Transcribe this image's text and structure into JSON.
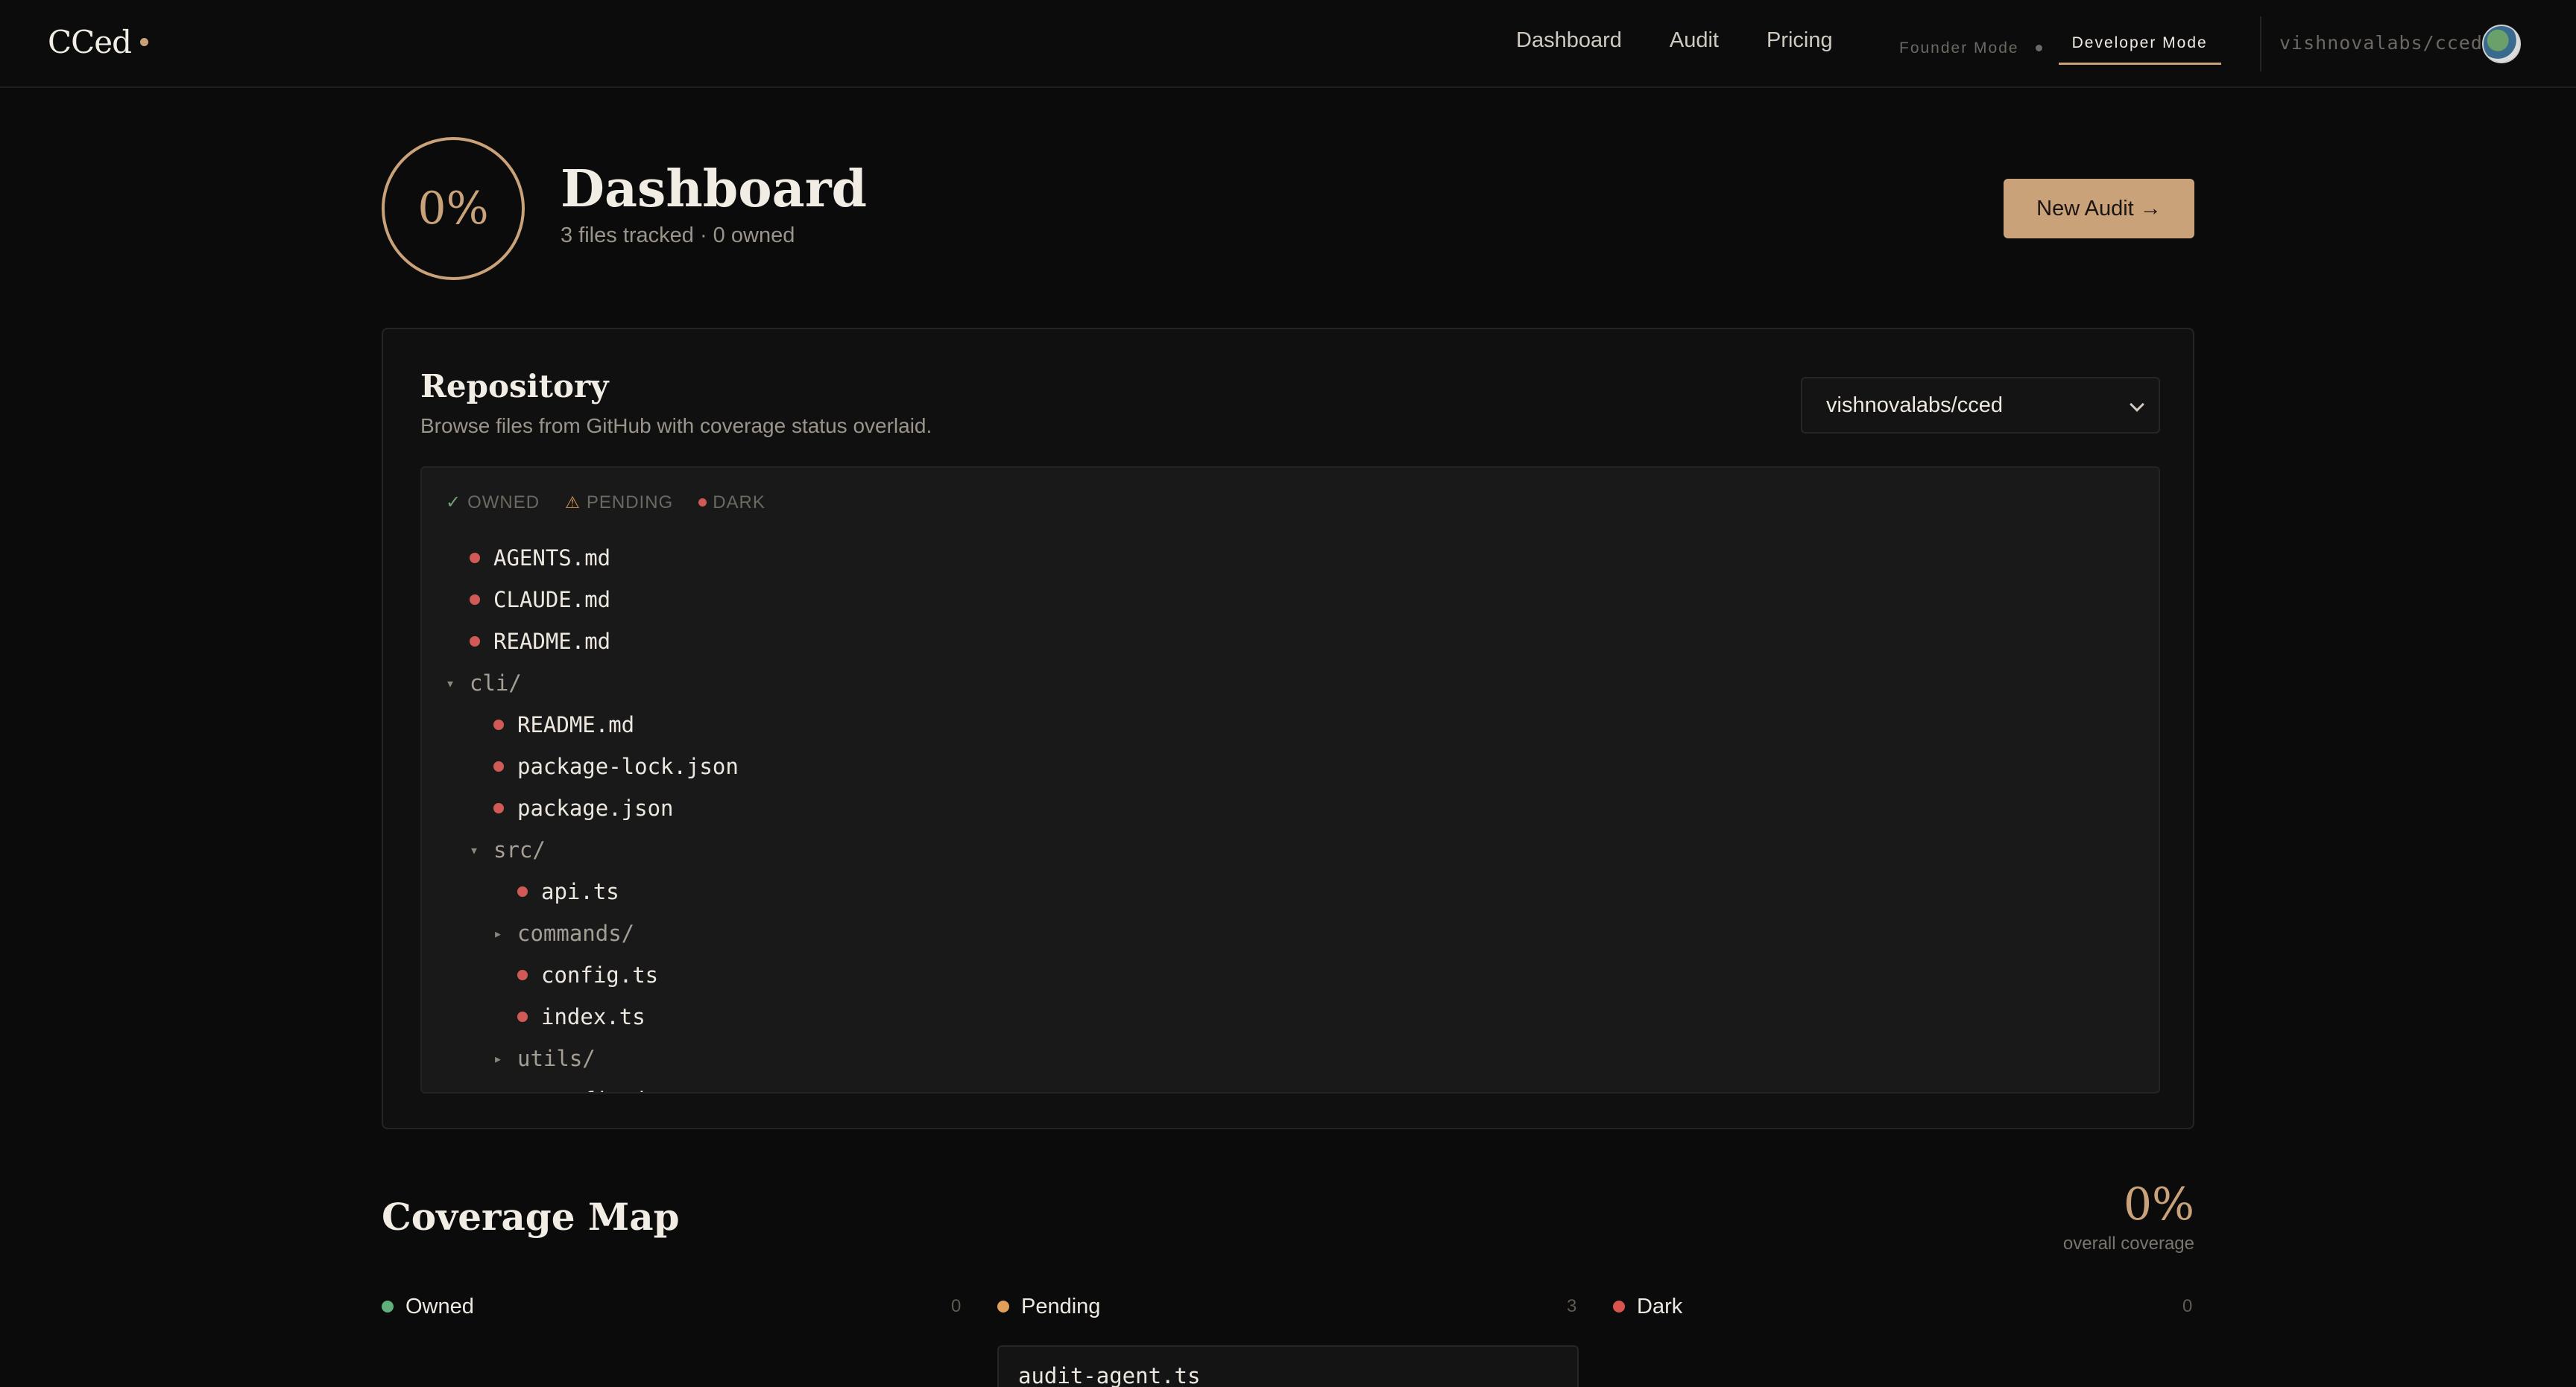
{
  "nav": {
    "logo": "CCed",
    "links": [
      "Dashboard",
      "Audit",
      "Pricing"
    ],
    "modes": {
      "founder": "Founder Mode",
      "developer": "Developer Mode",
      "active": "developer"
    },
    "repo": "vishnovalabs/cced"
  },
  "header": {
    "ring_pct": "0%",
    "title": "Dashboard",
    "subtitle": "3 files tracked · 0 owned",
    "new_audit": "New Audit →"
  },
  "repository": {
    "title": "Repository",
    "description": "Browse files from GitHub with coverage status overlaid.",
    "selected_repo": "vishnovalabs/cced",
    "legend": {
      "owned": "OWNED",
      "pending": "PENDING",
      "dark": "DARK"
    },
    "tree": [
      {
        "type": "file",
        "name": "AGENTS.md",
        "depth": 0,
        "status": "dark"
      },
      {
        "type": "file",
        "name": "CLAUDE.md",
        "depth": 0,
        "status": "dark"
      },
      {
        "type": "file",
        "name": "README.md",
        "depth": 0,
        "status": "dark"
      },
      {
        "type": "dir",
        "name": "cli/",
        "depth": 0,
        "expanded": true
      },
      {
        "type": "file",
        "name": "README.md",
        "depth": 1,
        "status": "dark"
      },
      {
        "type": "file",
        "name": "package-lock.json",
        "depth": 1,
        "status": "dark"
      },
      {
        "type": "file",
        "name": "package.json",
        "depth": 1,
        "status": "dark"
      },
      {
        "type": "dir",
        "name": "src/",
        "depth": 1,
        "expanded": true
      },
      {
        "type": "file",
        "name": "api.ts",
        "depth": 2,
        "status": "dark"
      },
      {
        "type": "dir",
        "name": "commands/",
        "depth": 2,
        "expanded": false
      },
      {
        "type": "file",
        "name": "config.ts",
        "depth": 2,
        "status": "dark"
      },
      {
        "type": "file",
        "name": "index.ts",
        "depth": 2,
        "status": "dark"
      },
      {
        "type": "dir",
        "name": "utils/",
        "depth": 2,
        "expanded": false
      },
      {
        "type": "file",
        "name": "tsconfig.json",
        "depth": 1,
        "status": "dark"
      }
    ]
  },
  "coverage": {
    "title": "Coverage Map",
    "overall_pct": "0%",
    "overall_label": "overall coverage",
    "columns": [
      {
        "label": "Owned",
        "count": "0",
        "color": "#5fae7c"
      },
      {
        "label": "Pending",
        "count": "3",
        "color": "#e0a05a"
      },
      {
        "label": "Dark",
        "count": "0",
        "color": "#d9534f"
      }
    ],
    "pending_items": [
      "audit-agent.ts"
    ]
  },
  "colors": {
    "accent": "#c9a27a",
    "owned": "#5fae7c",
    "pending": "#e0a05a",
    "dark": "#d05a56"
  }
}
